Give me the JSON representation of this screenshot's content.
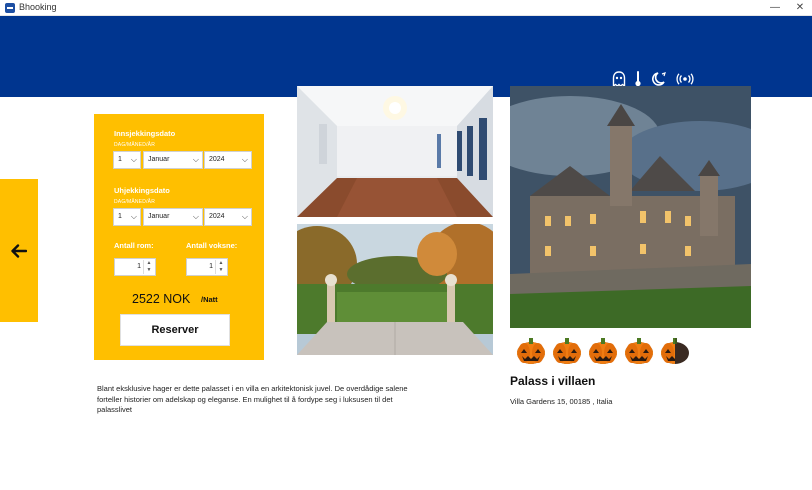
{
  "window": {
    "title": "Bhooking",
    "minimize": "—",
    "close": "✕"
  },
  "header": {
    "icons": [
      "ghost-icon",
      "thermometer-icon",
      "moon-icon",
      "broadcast-icon"
    ]
  },
  "nav": {
    "back_icon": "arrow-left-icon"
  },
  "booking": {
    "checkin_label": "Innsjekkingsdato",
    "checkin_format": "DAG/MÅNED/ÅR",
    "checkin_day": "1",
    "checkin_month": "Januar",
    "checkin_year": "2024",
    "checkout_label": "Uhjekkingsdato",
    "checkout_format": "DAG/MÅNED/ÅR",
    "checkout_day": "1",
    "checkout_month": "Januar",
    "checkout_year": "2024",
    "rooms_label": "Antall rom:",
    "rooms_value": "1",
    "adults_label": "Antall voksne:",
    "adults_value": "1",
    "price": "2522 NOK",
    "per_night": "/Natt",
    "reserve_label": "Reserver"
  },
  "description": "Blant eksklusive hager er dette palasset i en villa en arkitektonisk juvel. De overdådige salene forteller historier om adelskap og eleganse. En mulighet til å fordype seg i luksusen til det palasslivet",
  "hotel": {
    "name": "Palass i villaen",
    "address": "Villa Gardens 15, 00185 , Italia",
    "rating": 4.5,
    "rating_max": 5,
    "rating_icon": "pumpkin-icon"
  },
  "colors": {
    "header": "#00358f",
    "accent": "#ffbf00"
  }
}
